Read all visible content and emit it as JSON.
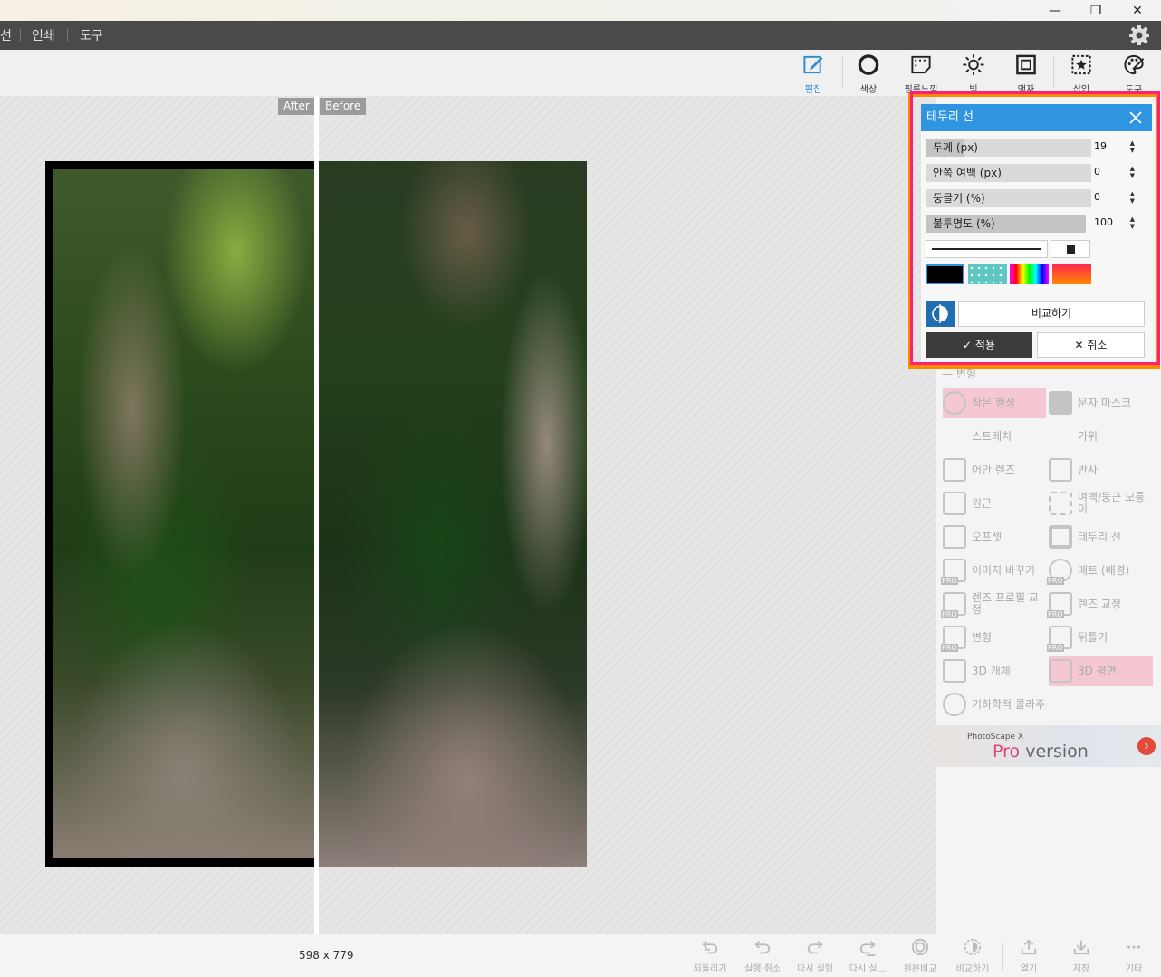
{
  "window": {
    "minimize": "—",
    "maximize": "❐",
    "close": "✕"
  },
  "menu": {
    "items": [
      "선",
      "인쇄",
      "도구"
    ]
  },
  "toolbar": {
    "tools": [
      {
        "label": "편집",
        "icon": "edit-icon",
        "active": true
      },
      {
        "label": "색상",
        "icon": "color-circle-icon"
      },
      {
        "label": "필름느낌",
        "icon": "film-icon"
      },
      {
        "label": "빛",
        "icon": "sun-icon"
      },
      {
        "label": "액자",
        "icon": "frame-icon"
      },
      {
        "label": "삽입",
        "icon": "insert-star-icon"
      },
      {
        "label": "도구",
        "icon": "palette-icon"
      }
    ]
  },
  "canvas": {
    "after_label": "After",
    "before_label": "Before"
  },
  "dialog": {
    "title": "테두리 선",
    "params": [
      {
        "label": "두께 (px)",
        "value": "19",
        "fill": 0.23
      },
      {
        "label": "안쪽 여백 (px)",
        "value": "0",
        "fill": 0
      },
      {
        "label": "둥글기 (%)",
        "value": "0",
        "fill": 0
      },
      {
        "label": "불투명도 (%)",
        "value": "100",
        "fill": 1
      }
    ],
    "swatches": [
      "black",
      "teal-dots",
      "rainbow",
      "red-orange"
    ],
    "compare_label": "비교하기",
    "apply_label": "적용",
    "cancel_label": "취소"
  },
  "panel": {
    "section": "변형",
    "items": [
      {
        "label": "작은 행성",
        "icon": "globe-icon",
        "pink": true
      },
      {
        "label": "문자 마스크",
        "icon": "text-mask-icon"
      },
      {
        "label": "스트레치",
        "icon": "stretch-icon"
      },
      {
        "label": "가위",
        "icon": "scissors-icon"
      },
      {
        "label": "어안 렌즈",
        "icon": "fisheye-icon"
      },
      {
        "label": "반사",
        "icon": "reflect-icon"
      },
      {
        "label": "원근",
        "icon": "perspective-icon"
      },
      {
        "label": "여백/둥근 모퉁이",
        "icon": "margin-icon"
      },
      {
        "label": "오프셋",
        "icon": "offset-icon"
      },
      {
        "label": "테두리 선",
        "icon": "border-icon"
      },
      {
        "label": "이미지 바꾸기",
        "icon": "replace-image-icon",
        "pro": true
      },
      {
        "label": "매트 (배경)",
        "icon": "matte-icon",
        "pro": true
      },
      {
        "label": "렌즈 프로필 교정",
        "icon": "lens-profile-icon",
        "pro": true
      },
      {
        "label": "렌즈 교정",
        "icon": "lens-correction-icon",
        "pro": true
      },
      {
        "label": "변형",
        "icon": "transform-icon",
        "pro": true
      },
      {
        "label": "뒤틀기",
        "icon": "warp-icon",
        "pro": true
      },
      {
        "label": "3D 개체",
        "icon": "cube-icon"
      },
      {
        "label": "3D 평면",
        "icon": "plane-icon",
        "pink": true
      },
      {
        "label": "기하학적 콜라주",
        "icon": "geometric-icon"
      }
    ],
    "promo_small": "PhotoScape X",
    "promo_pro": "Pro",
    "promo_version": " version"
  },
  "status": {
    "dimensions": "598 x 779",
    "buttons": [
      "되돌리기",
      "실행 취소",
      "다시 실행",
      "다시 실...",
      "원본비교",
      "비교하기",
      "열기",
      "저장",
      "기타"
    ]
  },
  "colors": {
    "accent": "#2f95e0",
    "highlight_pink": "#ff1e78",
    "highlight_orange": "#ff8c00"
  }
}
